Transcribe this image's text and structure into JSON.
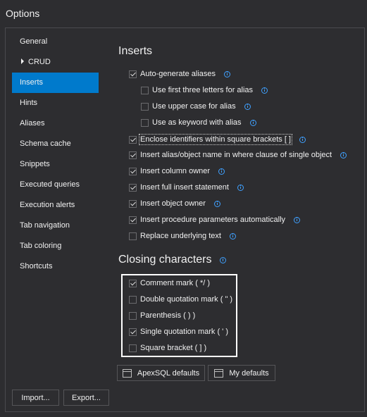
{
  "window": {
    "title": "Options"
  },
  "nav": {
    "items": [
      {
        "label": "General",
        "selected": false
      },
      {
        "label": "CRUD",
        "selected": false,
        "expandable": true
      },
      {
        "label": "Inserts",
        "selected": true
      },
      {
        "label": "Hints",
        "selected": false
      },
      {
        "label": "Aliases",
        "selected": false
      },
      {
        "label": "Schema cache",
        "selected": false
      },
      {
        "label": "Snippets",
        "selected": false
      },
      {
        "label": "Executed queries",
        "selected": false
      },
      {
        "label": "Execution alerts",
        "selected": false
      },
      {
        "label": "Tab navigation",
        "selected": false
      },
      {
        "label": "Tab coloring",
        "selected": false
      },
      {
        "label": "Shortcuts",
        "selected": false
      }
    ]
  },
  "inserts": {
    "title": "Inserts",
    "options": [
      {
        "label": "Auto-generate aliases",
        "checked": true,
        "info": true
      },
      {
        "label": "Use first three letters for alias",
        "checked": false,
        "info": true
      },
      {
        "label": "Use upper case for alias",
        "checked": false,
        "info": true
      },
      {
        "label": "Use as keyword with alias",
        "checked": false,
        "info": true
      },
      {
        "label": "Enclose identifiers within square brackets [ ]",
        "checked": true,
        "info": true
      },
      {
        "label": "Insert alias/object name in where clause of single object",
        "checked": true,
        "info": true
      },
      {
        "label": "Insert column owner",
        "checked": true,
        "info": true
      },
      {
        "label": "Insert full insert statement",
        "checked": true,
        "info": true
      },
      {
        "label": "Insert object owner",
        "checked": true,
        "info": true
      },
      {
        "label": "Insert procedure parameters automatically",
        "checked": true,
        "info": true
      },
      {
        "label": "Replace underlying text",
        "checked": false,
        "info": true
      }
    ]
  },
  "closing": {
    "title": "Closing characters",
    "options": [
      {
        "label": "Comment mark ( */ )",
        "checked": true
      },
      {
        "label": "Double quotation mark ( \" )",
        "checked": false
      },
      {
        "label": "Parenthesis ( ) )",
        "checked": false
      },
      {
        "label": "Single quotation mark ( ' )",
        "checked": true
      },
      {
        "label": "Square bracket ( ] )",
        "checked": false
      }
    ]
  },
  "buttons": {
    "apexsql_defaults": "ApexSQL defaults",
    "my_defaults": "My defaults",
    "import": "Import...",
    "export": "Export..."
  },
  "colors": {
    "accent": "#007acc",
    "background": "#2d2d30",
    "info": "#3fa0ff"
  }
}
